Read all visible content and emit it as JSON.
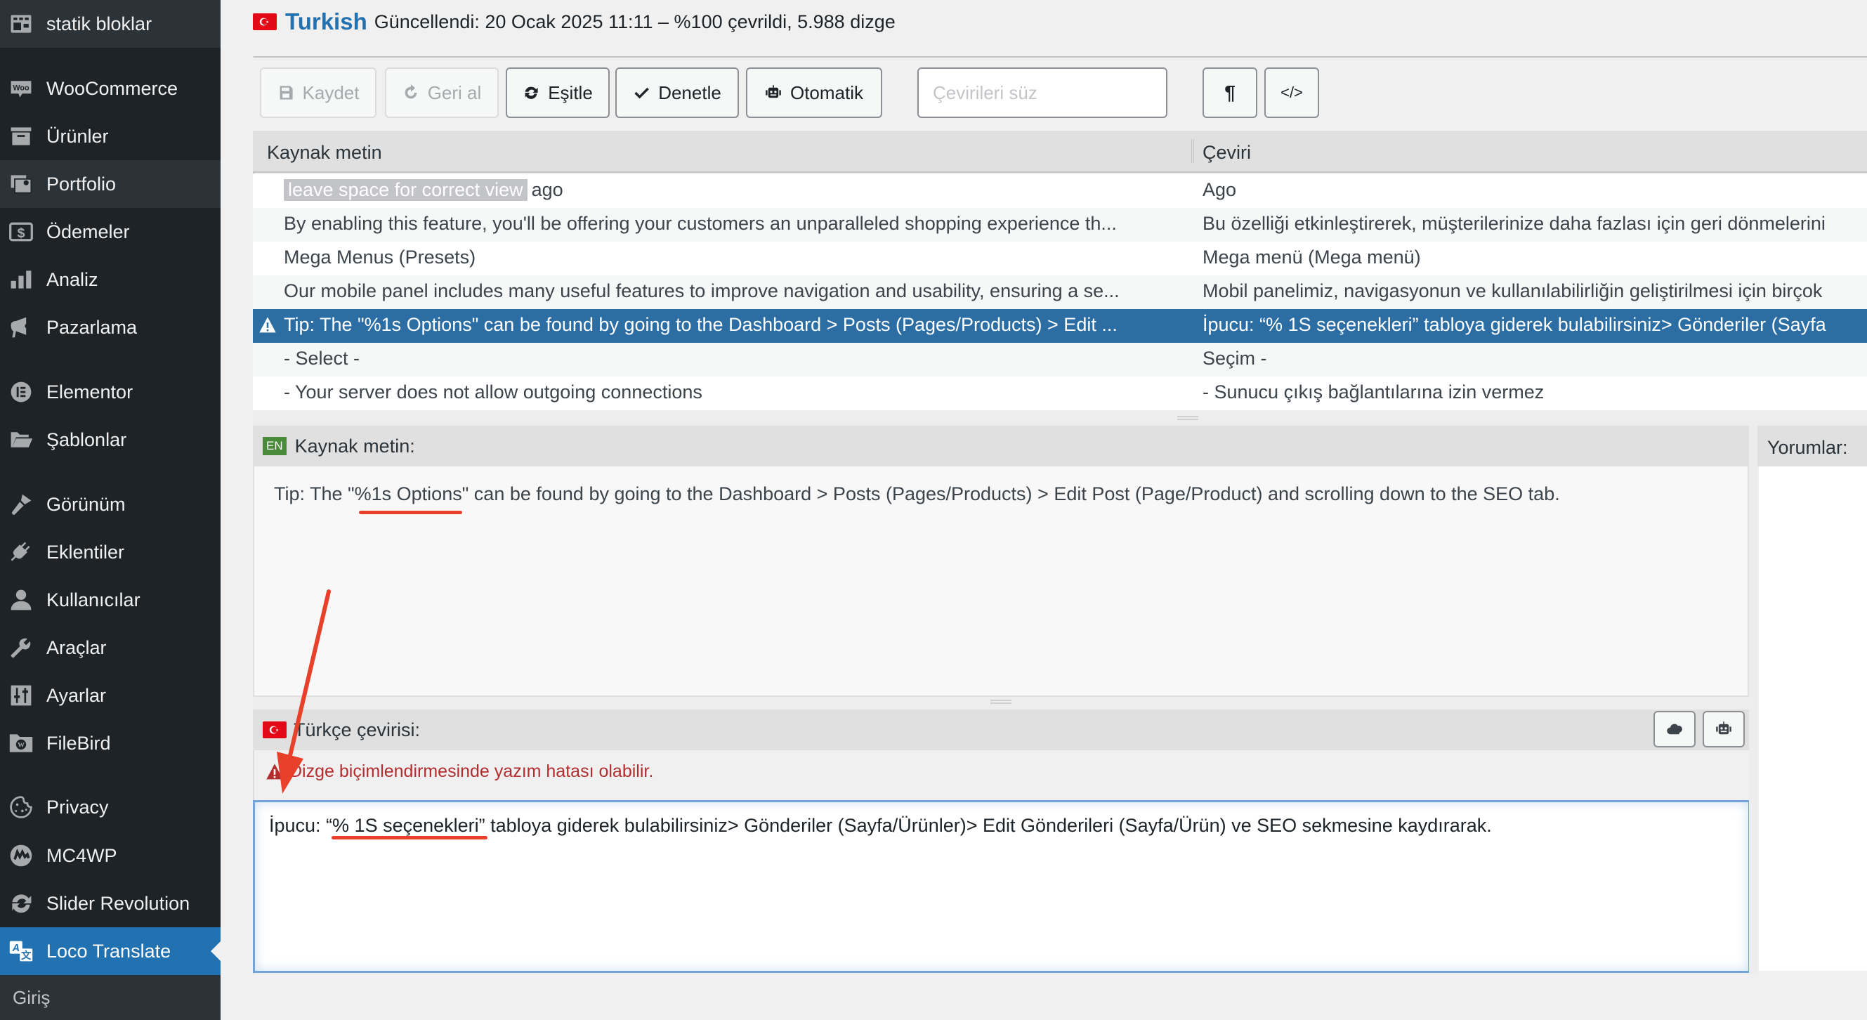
{
  "sidebar": {
    "items": [
      {
        "label": "statik bloklar",
        "icon": "table-layout-icon"
      },
      {
        "label": "WooCommerce",
        "icon": "woo-icon"
      },
      {
        "label": "Ürünler",
        "icon": "archive-box-icon"
      },
      {
        "label": "Portfolio",
        "icon": "portfolio-icon"
      },
      {
        "label": "Ödemeler",
        "icon": "dollar-icon"
      },
      {
        "label": "Analiz",
        "icon": "bar-chart-icon"
      },
      {
        "label": "Pazarlama",
        "icon": "megaphone-icon"
      },
      {
        "label": "Elementor",
        "icon": "elementor-icon"
      },
      {
        "label": "Şablonlar",
        "icon": "folder-open-icon"
      },
      {
        "label": "Görünüm",
        "icon": "paintbrush-icon"
      },
      {
        "label": "Eklentiler",
        "icon": "plugin-icon"
      },
      {
        "label": "Kullanıcılar",
        "icon": "user-icon"
      },
      {
        "label": "Araçlar",
        "icon": "wrench-icon"
      },
      {
        "label": "Ayarlar",
        "icon": "settings-sliders-icon"
      },
      {
        "label": "FileBird",
        "icon": "filebird-folder-icon"
      },
      {
        "label": "Privacy",
        "icon": "cookie-icon"
      },
      {
        "label": "MC4WP",
        "icon": "mc4wp-icon"
      },
      {
        "label": "Slider Revolution",
        "icon": "refresh-icon"
      },
      {
        "label": "Loco Translate",
        "icon": "translate-icon"
      }
    ],
    "submenu_first": "Giriş"
  },
  "header": {
    "language": "Turkish",
    "status": "Güncellendi: 20 Ocak 2025 11:11 – %100 çevrildi, 5.988 dizge"
  },
  "toolbar": {
    "save": "Kaydet",
    "revert": "Geri al",
    "sync": "Eşitle",
    "validate": "Denetle",
    "auto": "Otomatik",
    "filter_placeholder": "Çevirileri süz",
    "filter_value": ""
  },
  "table": {
    "col_source": "Kaynak metin",
    "col_translation": "Çeviri",
    "rows": [
      {
        "tag": "leave space for correct view",
        "source": "ago",
        "translation": "Ago",
        "selected": false,
        "warning": false
      },
      {
        "tag": "",
        "source": "By enabling this feature, you'll be offering your customers an unparalleled shopping experience th...",
        "translation": "Bu özelliği etkinleştirerek, müşterilerinize daha fazlası için geri dönmelerini",
        "selected": false,
        "warning": false
      },
      {
        "tag": "",
        "source": "Mega Menus (Presets)",
        "translation": "Mega menü (Mega menü)",
        "selected": false,
        "warning": false
      },
      {
        "tag": "",
        "source": "Our mobile panel includes many useful features to improve navigation and usability, ensuring a se...",
        "translation": "Mobil panelimiz, navigasyonun ve kullanılabilirliğin geliştirilmesi için birçok",
        "selected": false,
        "warning": false
      },
      {
        "tag": "",
        "source": "Tip: The \"%1s Options\" can be found by going to the Dashboard > Posts (Pages/Products) > Edit ...",
        "translation": "İpucu: “% 1S seçenekleri” tabloya giderek bulabilirsiniz> Gönderiler (Sayfa",
        "selected": true,
        "warning": true
      },
      {
        "tag": "",
        "source": "- Select -",
        "translation": "Seçim -",
        "selected": false,
        "warning": false
      },
      {
        "tag": "",
        "source": "- Your server does not allow outgoing connections",
        "translation": "- Sunucu çıkış bağlantılarına izin vermez",
        "selected": false,
        "warning": false
      }
    ]
  },
  "source_panel": {
    "badge": "EN",
    "label": "Kaynak metin:",
    "text_before": "Tip: The \"",
    "text_marked": "%1s Options",
    "text_after": "\" can be found by going to the Dashboard > Posts (Pages/Products) > Edit Post (Page/Product) and scrolling down to the SEO tab."
  },
  "translation_panel": {
    "label": "Türkçe çevirisi:",
    "warning": "Dizge biçimlendirmesinde yazım hatası olabilir.",
    "text": "İpucu: “% 1S seçenekleri” tabloya giderek bulabilirsiniz> Gönderiler (Sayfa/Ürünler)> Edit Gönderileri (Sayfa/Ürün) ve SEO sekmesine kaydırarak."
  },
  "comments_panel": {
    "label": "Yorumlar:"
  },
  "colors": {
    "accent": "#2271b1",
    "selected_row": "#2c6ea4",
    "warning": "#b32d2e",
    "annotation": "#e8402a"
  }
}
